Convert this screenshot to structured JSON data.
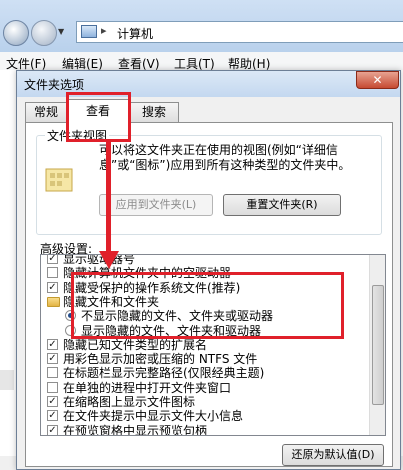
{
  "explorer": {
    "address_path": "计算机",
    "address_sep": "▸",
    "menu": [
      "文件(F)",
      "编辑(E)",
      "查看(V)",
      "工具(T)",
      "帮助(H)"
    ]
  },
  "dialog": {
    "title": "文件夹选项",
    "close_glyph": "✕",
    "tabs": [
      "常规",
      "查看",
      "搜索"
    ],
    "active_tab": "查看",
    "folder_views": {
      "group_label": "文件夹视图",
      "description": "可以将这文件夹正在使用的视图(例如“详细信息”或“图标”)应用到所有这种类型的文件夹中。",
      "apply_button": "应用到文件夹(L)",
      "reset_button": "重置文件夹(R)"
    },
    "advanced_label": "高级设置:",
    "advanced_items": [
      {
        "type": "checkbox",
        "checked": true,
        "label": "显示驱动器号"
      },
      {
        "type": "checkbox",
        "checked": false,
        "label": "隐藏计算机文件夹中的空驱动器"
      },
      {
        "type": "checkbox",
        "checked": true,
        "label": "隐藏受保护的操作系统文件(推荐)"
      },
      {
        "type": "folder",
        "label": "隐藏文件和文件夹"
      },
      {
        "type": "radio",
        "checked": true,
        "label": "不显示隐藏的文件、文件夹或驱动器"
      },
      {
        "type": "radio",
        "checked": false,
        "label": "显示隐藏的文件、文件夹和驱动器"
      },
      {
        "type": "checkbox",
        "checked": true,
        "label": "隐藏已知文件类型的扩展名"
      },
      {
        "type": "checkbox",
        "checked": true,
        "label": "用彩色显示加密或压缩的 NTFS 文件"
      },
      {
        "type": "checkbox",
        "checked": false,
        "label": "在标题栏显示完整路径(仅限经典主题)"
      },
      {
        "type": "checkbox",
        "checked": false,
        "label": "在单独的进程中打开文件夹窗口"
      },
      {
        "type": "checkbox",
        "checked": true,
        "label": "在缩略图上显示文件图标"
      },
      {
        "type": "checkbox",
        "checked": true,
        "label": "在文件夹提示中显示文件大小信息"
      },
      {
        "type": "checkbox",
        "checked": true,
        "label": "在预览窗格中显示预览句柄"
      }
    ],
    "restore_button": "还原为默认值(D)"
  },
  "colors": {
    "annotation_red": "#e0202a",
    "accent_blue": "#244d8a"
  }
}
